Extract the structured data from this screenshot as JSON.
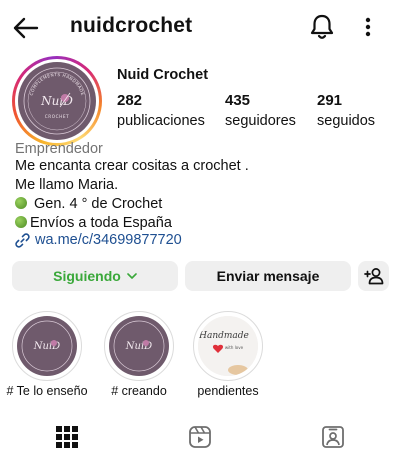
{
  "header": {
    "username": "nuidcrochet",
    "back_icon": "arrow-left-icon",
    "bell_icon": "bell-icon",
    "more_icon": "vertical-dots-icon"
  },
  "profile": {
    "display_name": "Nuid Crochet",
    "avatar_text_top": "COMPLEMENTS HANDMADE",
    "avatar_text_center": "NuiD",
    "avatar_text_bottom": "CROCHET",
    "stats": [
      {
        "value": "282",
        "label": "publicaciones"
      },
      {
        "value": "435",
        "label": "seguidores"
      },
      {
        "value": "291",
        "label": "seguidos"
      }
    ],
    "category": "Emprendedor",
    "bio": [
      "Me encanta crear cositas a crochet .",
      "Me llamo Maria.",
      " Gen. 4 ° de Crochet",
      "Envíos a toda España"
    ],
    "link": "wa.me/c/34699877720"
  },
  "actions": {
    "following_label": "Siguiendo",
    "message_label": "Enviar mensaje",
    "add_user_icon": "add-user-icon"
  },
  "highlights": [
    {
      "label": "# Te lo enseño"
    },
    {
      "label": "# creando"
    },
    {
      "label": "pendientes",
      "image_text": "Handmade",
      "image_subtext": "with love"
    }
  ],
  "tabs": [
    {
      "icon": "grid-icon",
      "active": true
    },
    {
      "icon": "reels-icon",
      "active": false
    },
    {
      "icon": "tagged-icon",
      "active": false
    }
  ],
  "colors": {
    "following_text": "#3aa83a",
    "link_text": "#1e4f91",
    "button_bg": "#efefef",
    "avatar_bg": "#6f5a6c"
  }
}
